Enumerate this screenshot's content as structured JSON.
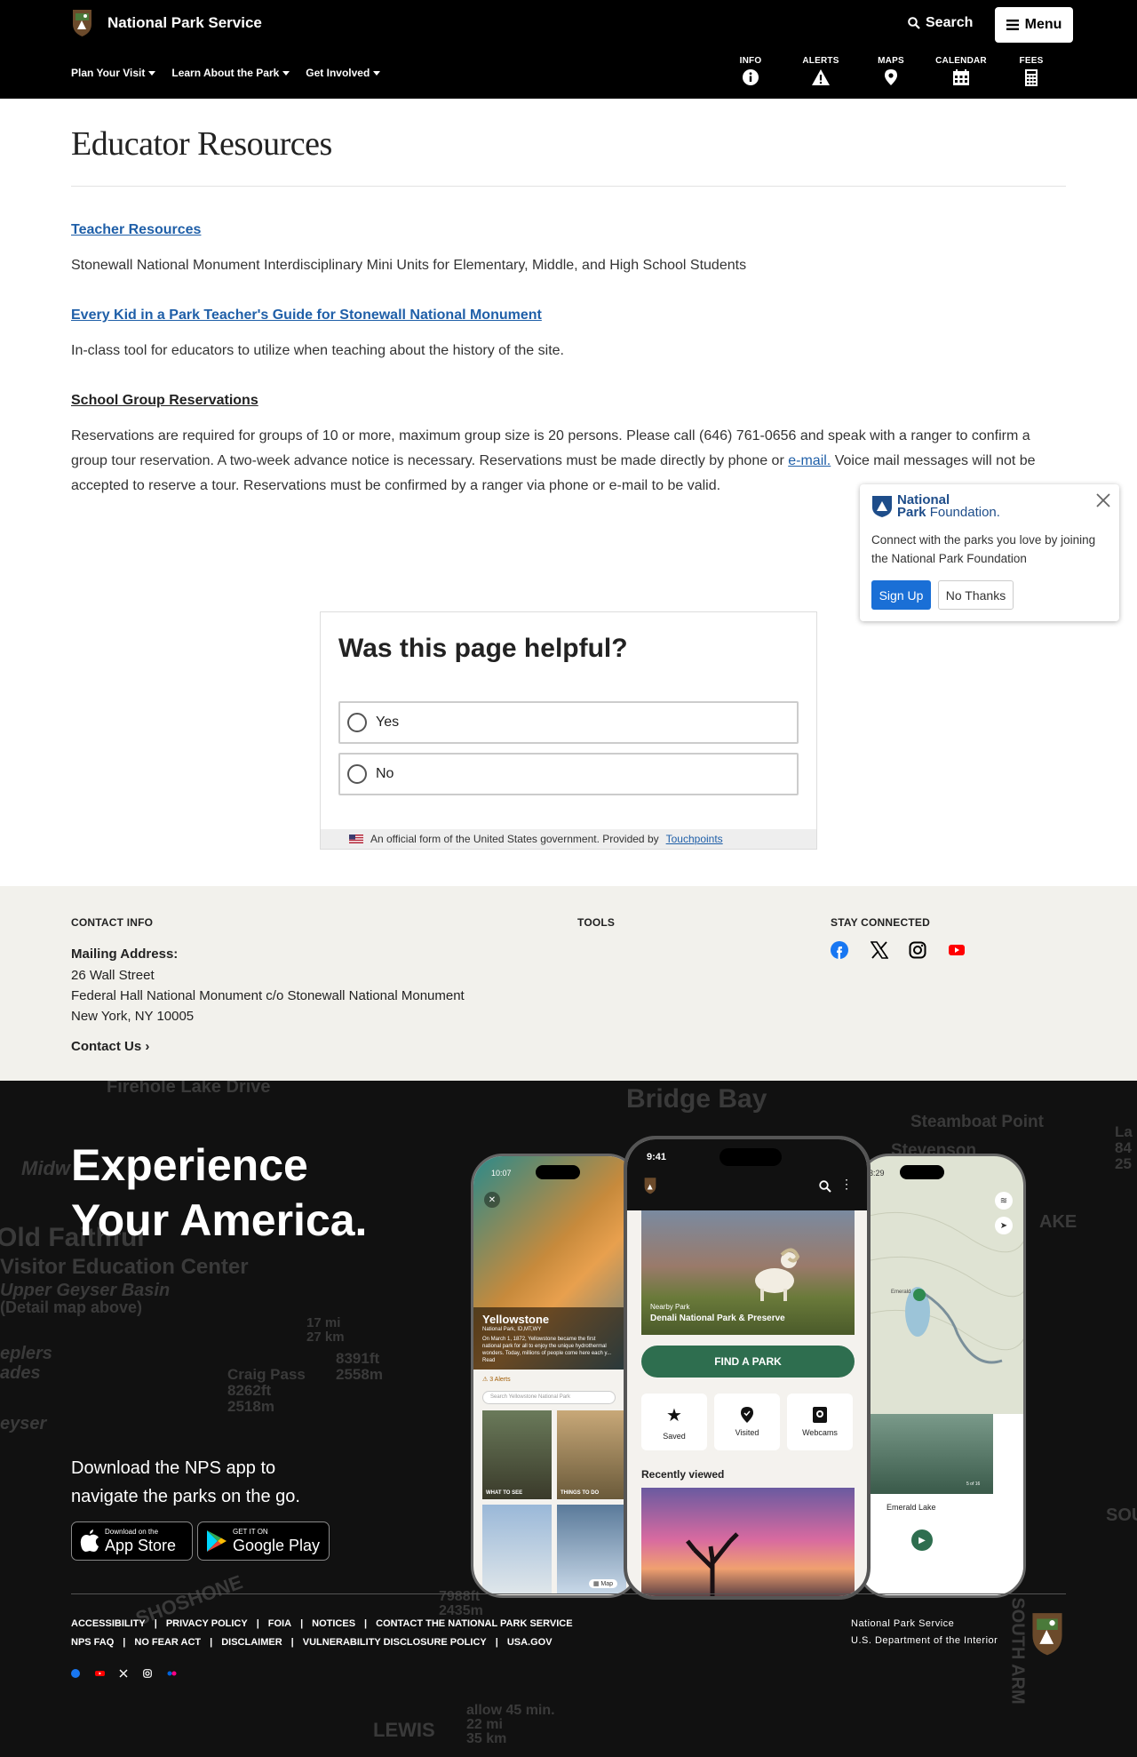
{
  "header": {
    "site_title": "National Park Service",
    "search_label": "Search",
    "menu_label": "Menu",
    "nav": [
      {
        "label": "Plan Your Visit"
      },
      {
        "label": "Learn About the Park"
      },
      {
        "label": "Get Involved"
      }
    ],
    "quick_links": [
      {
        "label": "INFO",
        "icon": "info-icon"
      },
      {
        "label": "ALERTS",
        "icon": "alert-icon"
      },
      {
        "label": "MAPS",
        "icon": "map-pin-icon"
      },
      {
        "label": "CALENDAR",
        "icon": "calendar-icon"
      },
      {
        "label": "FEES",
        "icon": "fees-icon"
      }
    ]
  },
  "main": {
    "title": "Educator Resources",
    "resources": [
      {
        "link": "Teacher Resources",
        "desc": "Stonewall National Monument Interdisciplinary Mini Units for Elementary, Middle, and High School Students"
      },
      {
        "link": "Every Kid in a Park Teacher's Guide for Stonewall National Monument",
        "desc": "In-class tool for educators to utilize when teaching about the history of the site."
      }
    ],
    "reservations": {
      "heading": "School Group Reservations",
      "text_before": "Reservations are required for groups of 10 or more, maximum group size is 20 persons. Please call (646) 761-0656 and speak with a ranger to confirm a group tour reservation. A two-week advance notice is necessary. Reservations must be made directly by phone or ",
      "email_link": "e-mail.",
      "text_after": " Voice mail messages will not be accepted to reserve a tour. Reservations must be confirmed by a ranger via phone or e-mail to be valid."
    }
  },
  "npf_popup": {
    "logo_line1": "National",
    "logo_line2a": "Park",
    "logo_line2b": "Foundation.",
    "message": "Connect with the parks you love by joining the National Park Foundation",
    "signup_label": "Sign Up",
    "nothanks_label": "No Thanks"
  },
  "feedback": {
    "title": "Was this page helpful?",
    "options": [
      "Yes",
      "No"
    ],
    "footer_text": "An official form of the United States government. Provided by",
    "footer_link": "Touchpoints"
  },
  "contact": {
    "contact_heading": "CONTACT INFO",
    "tools_heading": "TOOLS",
    "stay_heading": "STAY CONNECTED",
    "mailing_label": "Mailing Address:",
    "address": [
      "26 Wall Street",
      "Federal Hall National Monument c/o Stonewall National Monument",
      "New York, NY 10005"
    ],
    "contact_us": "Contact Us",
    "social": [
      "facebook-icon",
      "x-icon",
      "instagram-icon",
      "youtube-icon"
    ]
  },
  "app_promo": {
    "title_line1": "Experience",
    "title_line2": "Your America.",
    "download_text": "Download the NPS app to navigate the parks on the go.",
    "appstore_small": "Download on the",
    "appstore_big": "App Store",
    "googleplay_small": "GET IT ON",
    "googleplay_big": "Google Play",
    "map_labels": [
      "Firehole Lake Drive",
      "Bridge Bay",
      "Steamboat Point",
      "Stevenson",
      "Midw",
      "Old Faithful",
      "Visitor Education Center",
      "Upper Geyser Basin",
      "(Detail map above)",
      "17 mi",
      "27 km",
      "8391ft",
      "2558m",
      "Craig Pass",
      "8262ft",
      "2518m",
      "eyser",
      "SHOSHONE",
      "LEWIS",
      "allow 45 min.",
      "22 mi",
      "35 km",
      "7988ft",
      "2435m",
      "SOUTH ARM",
      "AKE",
      "La",
      "84",
      "25",
      "eplers",
      "ades",
      "SOU"
    ],
    "phone_left": {
      "time": "10:07",
      "park": "Yellowstone",
      "sub": "National Park, ID,MT,WY",
      "blurb": "On March 1, 1872, Yellowstone became the first national park for all to enjoy the unique hydrothermal wonders. Today, millions of people come here each y... Read",
      "alerts": "3 Alerts",
      "search": "Search Yellowstone National Park",
      "tile1": "WHAT TO SEE",
      "tile2": "THINGS TO DO",
      "map": "Map"
    },
    "phone_center": {
      "time": "9:41",
      "nearby": "Nearby Park",
      "park": "Denali National Park & Preserve",
      "cta": "FIND A PARK",
      "tiles": [
        "Saved",
        "Visited",
        "Webcams"
      ],
      "recent": "Recently viewed"
    },
    "phone_right": {
      "time": "3:29",
      "lake": "Emerald Lake",
      "count": "5 of 16",
      "pin": "Emerald"
    }
  },
  "footer": {
    "links_row1": [
      "ACCESSIBILITY",
      "PRIVACY POLICY",
      "FOIA",
      "NOTICES",
      "CONTACT THE NATIONAL PARK SERVICE"
    ],
    "links_row2": [
      "NPS FAQ",
      "NO FEAR ACT",
      "DISCLAIMER",
      "VULNERABILITY DISCLOSURE POLICY",
      "USA.GOV"
    ],
    "agency_line1": "National Park Service",
    "agency_line2": "U.S. Department of the Interior",
    "mini_social": [
      "facebook-icon",
      "youtube-icon",
      "x-icon",
      "instagram-icon",
      "flickr-icon"
    ]
  },
  "colors": {
    "header_bg": "#000000",
    "link_blue": "#1f5fa8",
    "contact_bg": "#f2f1ec",
    "signup_blue": "#1a6fd6",
    "find_park_green": "#2e6e4f"
  }
}
